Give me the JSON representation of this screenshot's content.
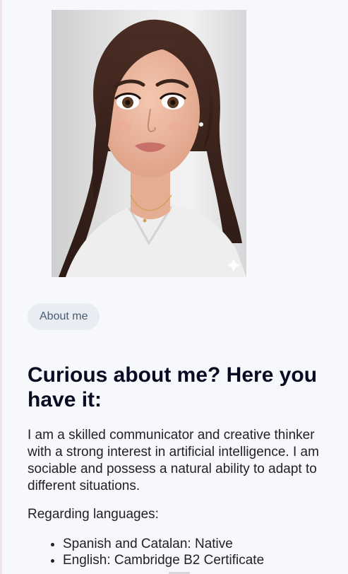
{
  "profile": {
    "photo_alt": "Portrait"
  },
  "about": {
    "pill_label": "About me",
    "heading": "Curious about me? Here you have it:",
    "intro": "I am a skilled communicator and creative thinker with a strong interest in artificial intelligence. I am sociable and possess a natural ability to adapt to different situations.",
    "languages_title": "Regarding languages:",
    "languages": [
      "Spanish and Catalan: Native",
      "English: Cambridge B2 Certificate"
    ]
  }
}
